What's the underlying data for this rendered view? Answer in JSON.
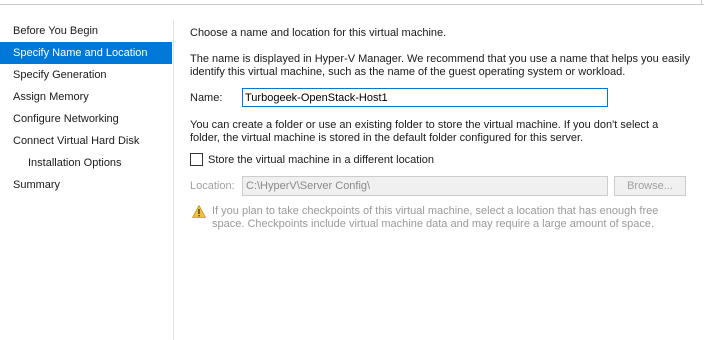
{
  "sidebar": {
    "items": [
      {
        "label": "Before You Begin"
      },
      {
        "label": "Specify Name and Location"
      },
      {
        "label": "Specify Generation"
      },
      {
        "label": "Assign Memory"
      },
      {
        "label": "Configure Networking"
      },
      {
        "label": "Connect Virtual Hard Disk"
      },
      {
        "label": "Installation Options"
      },
      {
        "label": "Summary"
      }
    ],
    "selected": "Specify Name and Location"
  },
  "main": {
    "heading": "Choose a name and location for this virtual machine.",
    "name_help_line1": "The name is displayed in Hyper-V Manager. We recommend that you use a name that helps you easily",
    "name_help_line2": "identify this virtual machine, such as the name of the guest operating system or workload.",
    "name_label": "Name:",
    "name_value": "Turbogeek-OpenStack-Host1",
    "folder_help_line1": "You can create a folder or use an existing folder to store the virtual machine. If you don't select a",
    "folder_help_line2": "folder, the virtual machine is stored in the default folder configured for this server.",
    "store_checkbox_label": "Store the virtual machine in a different location",
    "store_checkbox_checked": false,
    "location_label": "Location:",
    "location_value": "C:\\HyperV\\Server Config\\",
    "browse_label": "Browse...",
    "warning_line1": "If you plan to take checkpoints of this virtual machine, select a location that has enough free",
    "warning_line2": "space. Checkpoints include virtual machine data and may require a large amount of space.",
    "warning_icon": "warning-triangle-icon"
  },
  "colors": {
    "selection": "#0078d7",
    "disabled_text": "#a0a0a0",
    "warning_icon": "#f0c23b"
  }
}
